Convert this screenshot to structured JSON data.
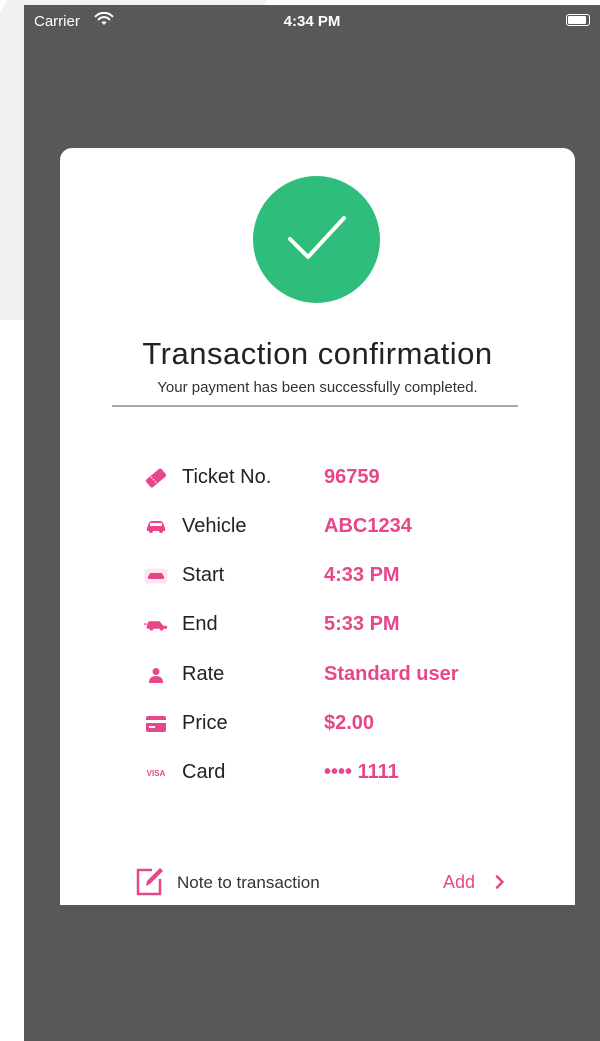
{
  "status": {
    "carrier": "Carrier",
    "time": "4:34 PM"
  },
  "confirmation": {
    "title": "Transaction confirmation",
    "subtitle": "Your payment has been successfully completed."
  },
  "details": [
    {
      "icon": "ticket-icon",
      "label": "Ticket No.",
      "value": "96759"
    },
    {
      "icon": "car-icon",
      "label": "Vehicle",
      "value": "ABC1234"
    },
    {
      "icon": "car-start-icon",
      "label": "Start",
      "value": "4:33 PM"
    },
    {
      "icon": "car-end-icon",
      "label": "End",
      "value": "5:33 PM"
    },
    {
      "icon": "user-icon",
      "label": "Rate",
      "value": "Standard user"
    },
    {
      "icon": "credit-card-icon",
      "label": "Price",
      "value": "$2.00"
    },
    {
      "icon": "visa-icon",
      "label": "Card",
      "value": "•••• 1111"
    }
  ],
  "note": {
    "label": "Note to transaction",
    "action": "Add"
  },
  "colors": {
    "accent": "#e8468b",
    "success": "#2fbd7c",
    "background": "#58585a"
  }
}
